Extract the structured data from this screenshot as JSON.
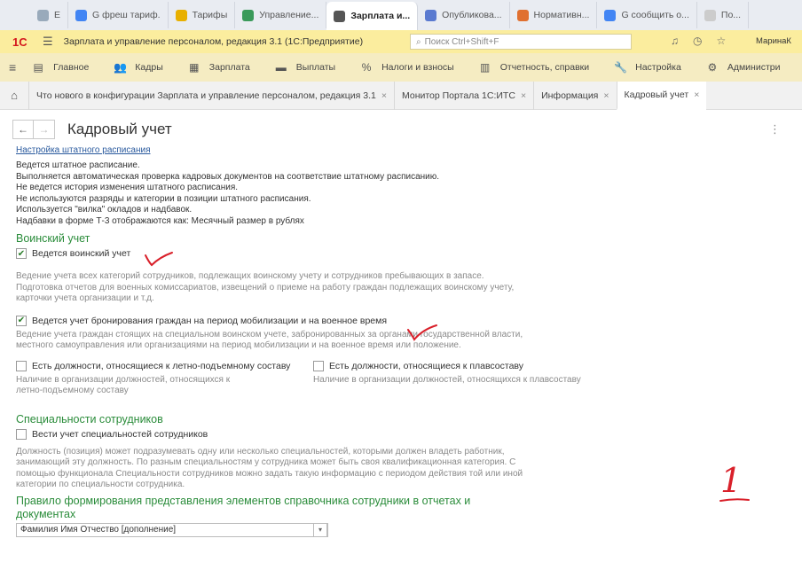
{
  "browser_tabs": [
    {
      "label": "E",
      "icon": "page-icon",
      "color": "#9ab"
    },
    {
      "label": "G фреш тариф.",
      "icon": "google-icon",
      "color": "#4285f4"
    },
    {
      "label": "Тарифы",
      "icon": "bookmark-icon",
      "color": "#e8b000"
    },
    {
      "label": "Управление...",
      "icon": "sc-icon",
      "color": "#3a9a5a"
    },
    {
      "label": "Зарплата и...",
      "icon": "app-icon",
      "color": "#555"
    },
    {
      "label": "Опубликова...",
      "icon": "globe-icon",
      "color": "#5a7ad0"
    },
    {
      "label": "Нормативн...",
      "icon": "doc-icon",
      "color": "#e07030"
    },
    {
      "label": "G сообщить о...",
      "icon": "google-icon",
      "color": "#4285f4"
    },
    {
      "label": "По...",
      "icon": "page-icon",
      "color": "#ccc"
    }
  ],
  "app": {
    "logo": "1С",
    "title": "Зарплата и управление персоналом, редакция 3.1  (1С:Предприятие)",
    "search_placeholder": "Поиск Ctrl+Shift+F",
    "user": "МаринаК"
  },
  "sections": [
    {
      "label": "Главное",
      "icon": "list-icon",
      "glyph": "▤"
    },
    {
      "label": "Кадры",
      "icon": "people-icon",
      "glyph": "👥"
    },
    {
      "label": "Зарплата",
      "icon": "calculator-icon",
      "glyph": "▦"
    },
    {
      "label": "Выплаты",
      "icon": "cash-icon",
      "glyph": "▬"
    },
    {
      "label": "Налоги и взносы",
      "icon": "percent-icon",
      "glyph": "%"
    },
    {
      "label": "Отчетность, справки",
      "icon": "report-icon",
      "glyph": "▥"
    },
    {
      "label": "Настройка",
      "icon": "wrench-icon",
      "glyph": "🔧"
    },
    {
      "label": "Администри",
      "icon": "gear-icon",
      "glyph": "⚙"
    }
  ],
  "open_windows": [
    {
      "label": "Что нового в конфигурации Зарплата и управление персоналом, редакция 3.1"
    },
    {
      "label": "Монитор Портала 1С:ИТС"
    },
    {
      "label": "Информация"
    },
    {
      "label": "Кадровый учет",
      "active": true
    }
  ],
  "form": {
    "title": "Кадровый учет",
    "staffing_link": "Настройка штатного расписания",
    "staffing_info": [
      "Ведется штатное расписание.",
      "Выполняется автоматическая проверка кадровых документов на соответствие штатному расписанию.",
      "Не ведется история изменения штатного расписания.",
      "Не используются разряды и категории в позиции штатного расписания.",
      "Используется \"вилка\" окладов и надбавок.",
      "Надбавки в форме Т-3 отображаются как: Месячный размер в рублях"
    ],
    "military": {
      "title": "Воинский учет",
      "cb1_label": "Ведется воинский учет",
      "cb1_checked": true,
      "cb1_hint": [
        "Ведение учета всех категорий сотрудников, подлежащих воинскому учету и сотрудников пребывающих в запасе.",
        "Подготовка отчетов для военных комиссариатов, извещений о приеме на работу граждан подлежащих воинскому учету,",
        "карточки учета организации и т.д."
      ],
      "cb2_label": "Ведется учет бронирования граждан на период мобилизации и на военное время",
      "cb2_checked": true,
      "cb2_hint": [
        "Ведение учета граждан стоящих на специальном воинском учете, забронированных за органами государственной власти,",
        "местного самоуправления или организациями на период мобилизации и на военное время или положение."
      ],
      "cb3_label": "Есть должности, относящиеся к летно-подъемному составу",
      "cb3_checked": false,
      "cb3_hint": [
        "Наличие в организации должностей, относящихся к",
        "летно-подъемному составу"
      ],
      "cb4_label": "Есть должности, относящиеся к плавсоставу",
      "cb4_checked": false,
      "cb4_hint": [
        "Наличие в организации должностей, относящихся к плавсоставу"
      ]
    },
    "specialties": {
      "title": "Специальности сотрудников",
      "cb_label": "Вести учет специальностей сотрудников",
      "cb_checked": false,
      "hint": [
        "Должность (позиция) может подразумевать одну или несколько специальностей, которыми должен владеть работник,",
        "занимающий эту должность. По разным специальностям у сотрудника может быть своя квалификационная категория. С",
        "помощью функционала Специальности сотрудников можно задать такую информацию с периодом действия той или иной",
        "категории по специальности сотрудника."
      ]
    },
    "representation": {
      "title_line1": "Правило формирования представления элементов справочника сотрудники в отчетах и",
      "title_line2": "документах",
      "select_value": "Фамилия Имя Отчество [дополнение]"
    }
  },
  "annotations": {
    "handwritten_number": "1",
    "ink_color": "#d9202a"
  }
}
